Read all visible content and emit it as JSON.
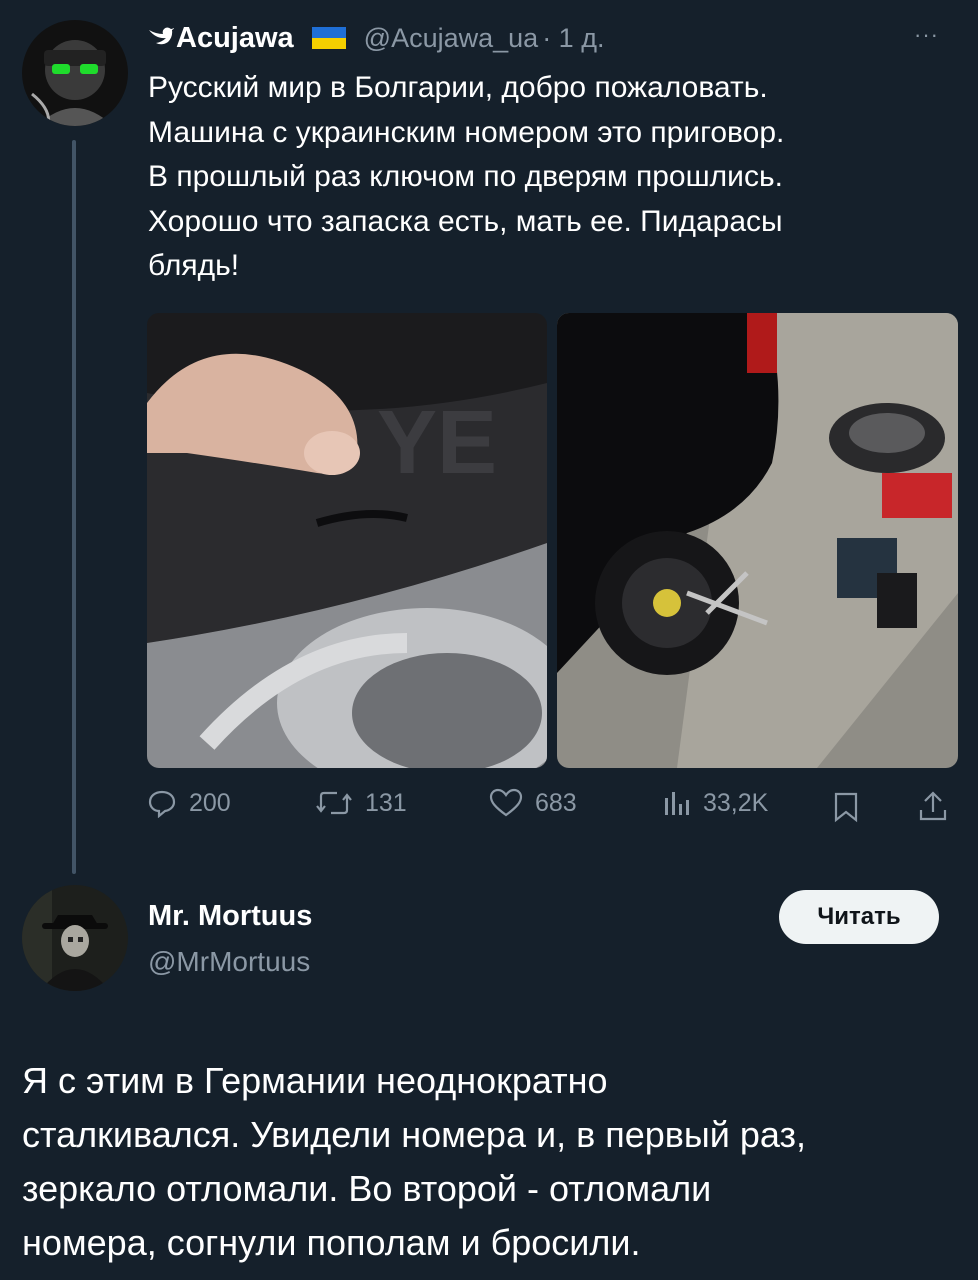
{
  "tweet": {
    "author_name": "Acujawa",
    "author_handle": "@Acujawa_ua",
    "time": "· 1 д.",
    "more": "···",
    "text": "Русский мир в Болгарии, добро пожаловать.\nМашина с украинским номером это приговор.\nВ прошлый раз ключом по дверям прошлись.\nХорошо что запаска есть, мать ее. Пидарасы\nблядь!",
    "flag_colors": [
      "#1f6fd6",
      "#f5d000"
    ],
    "images": [
      {
        "icon": "tire-photo",
        "description": ""
      },
      {
        "icon": "car-spare-wheel-photo",
        "description": ""
      }
    ],
    "actions": {
      "replies": "200",
      "retweets": "131",
      "likes": "683",
      "views": "33,2K"
    }
  },
  "reply_author": {
    "name": "Mr. Mortuus",
    "handle": "@MrMortuus",
    "follow_label": "Читать"
  },
  "reply": {
    "text": "Я с этим в Германии неоднократно\nсталкивался. Увидели номера и, в первый раз,\nзеркало отломали. Во второй - отломали\nномера, согнули пополам и бросили."
  },
  "colors": {
    "background": "#15202b",
    "muted": "#8b98a5",
    "button_bg": "#eff3f4"
  }
}
